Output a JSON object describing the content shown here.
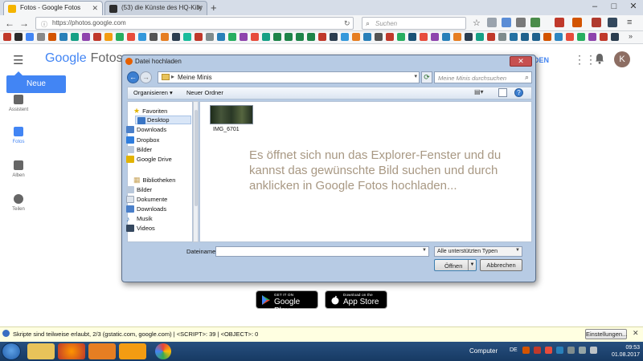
{
  "browser": {
    "tabs": [
      {
        "label": "Fotos - Google Fotos",
        "active": true
      },
      {
        "label": "(53) die Künste des HQ-Killy",
        "active": false
      }
    ],
    "url": "https://photos.google.com",
    "search_placeholder": "Suchen"
  },
  "photos": {
    "logo_text": "Google",
    "product_name": "Fotos",
    "header_edge_text": "DEN",
    "avatar_letter": "K",
    "new_features_label": "Neue Funktionen",
    "sidebar": [
      {
        "label": "Assistent",
        "icon": "assistant-icon"
      },
      {
        "label": "Fotos",
        "icon": "photo-icon"
      },
      {
        "label": "Alben",
        "icon": "album-icon"
      },
      {
        "label": "Teilen",
        "icon": "people-icon"
      }
    ],
    "store_badges": [
      {
        "small": "GET IT ON",
        "big": "Google Play"
      },
      {
        "small": "Download on the",
        "big": "App Store"
      }
    ]
  },
  "dialog": {
    "title": "Datei hochladen",
    "path": "Meine Minis",
    "search_placeholder": "Meine Minis durchsuchen",
    "toolbar": {
      "organize": "Organisieren ▾",
      "new_folder": "Neuer Ordner"
    },
    "favorites_header": "Favoriten",
    "favorites": [
      "Desktop",
      "Downloads",
      "Dropbox",
      "Bilder",
      "Google Drive"
    ],
    "selected_favorite": "Desktop",
    "libraries_header": "Bibliotheken",
    "libraries": [
      "Bilder",
      "Dokumente",
      "Downloads",
      "Musik",
      "Videos"
    ],
    "file": {
      "name": "IMG_6701"
    },
    "overlay_text": "Es öffnet sich nun das Explorer-Fenster und du kannst das gewünschte Bild suchen und durch anklicken in Google Fotos hochladen...",
    "filename_label": "Dateiname:",
    "filename_value": "",
    "file_type": "Alle unterstützten Typen",
    "open_label": "Öffnen",
    "cancel_label": "Abbrechen"
  },
  "notification": {
    "text": "Skripte sind teilweise erlaubt, 2/3 (gstatic.com, google.com) | <SCRIPT>: 39 | <OBJECT>: 0",
    "button": "Einstellungen..."
  },
  "taskbar": {
    "computer_label": "Computer",
    "lang": "DE",
    "time": "09:53",
    "date": "01.08.2017"
  }
}
